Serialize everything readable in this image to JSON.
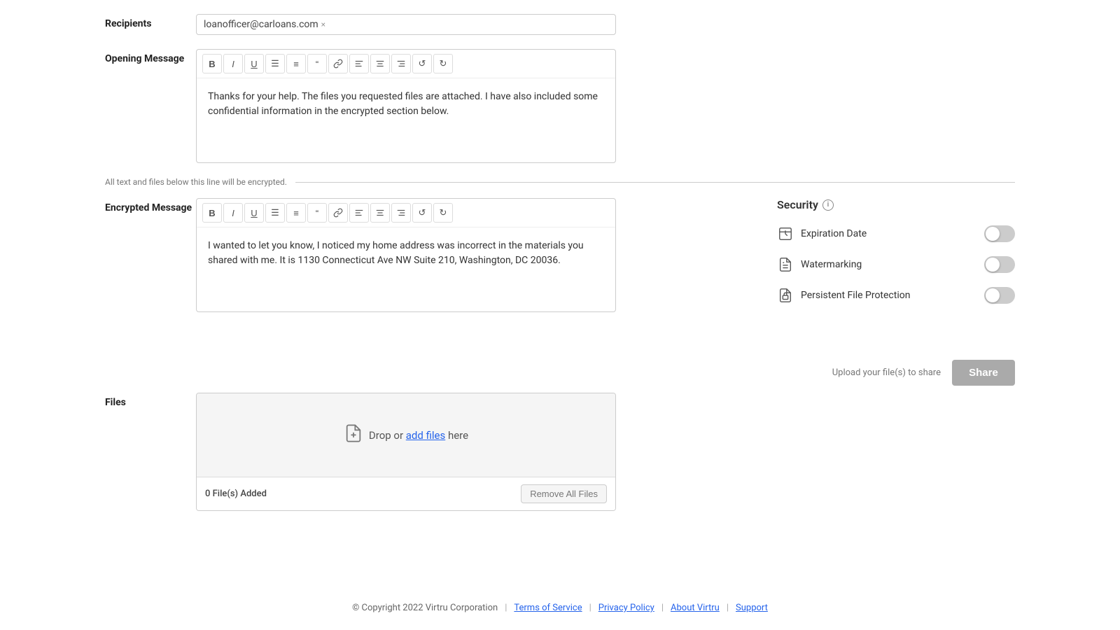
{
  "form": {
    "recipients_label": "Recipients",
    "recipient_email": "loanofficer@carloans.com",
    "opening_message_label": "Opening Message",
    "opening_message_body": "Thanks for your help. The files you requested files are attached. I have also included some confidential information in the encrypted section below.",
    "encrypted_message_label": "Encrypted Message",
    "encrypted_message_body": "I wanted to let you know, I noticed my home address was incorrect in the materials you shared with me. It is 1130 Connecticut Ave NW Suite 210, Washington, DC 20036.",
    "files_label": "Files",
    "files_count": "0 File(s) Added",
    "remove_all_files_label": "Remove All Files",
    "drop_text_prefix": "Drop or ",
    "add_files_link": "add files",
    "drop_text_suffix": " here"
  },
  "divider": {
    "text": "All text and files below this line will be encrypted."
  },
  "security": {
    "title": "Security",
    "expiration_date_label": "Expiration Date",
    "watermarking_label": "Watermarking",
    "persistent_file_protection_label": "Persistent File Protection",
    "expiration_date_on": false,
    "watermarking_on": false,
    "persistent_file_protection_on": false
  },
  "share": {
    "upload_hint": "Upload your file(s) to share",
    "share_label": "Share"
  },
  "toolbar": {
    "bold": "B",
    "italic": "I",
    "underline": "U",
    "bullet_list": "☰",
    "numbered_list": "≡",
    "blockquote": "❝",
    "link": "🔗",
    "align_left": "⬛",
    "align_center": "⬛",
    "align_right": "⬛",
    "undo": "↺",
    "redo": "↻"
  },
  "footer": {
    "copyright": "© Copyright 2022 Virtru Corporation",
    "terms_label": "Terms of Service",
    "privacy_label": "Privacy Policy",
    "about_label": "About Virtru",
    "support_label": "Support"
  }
}
